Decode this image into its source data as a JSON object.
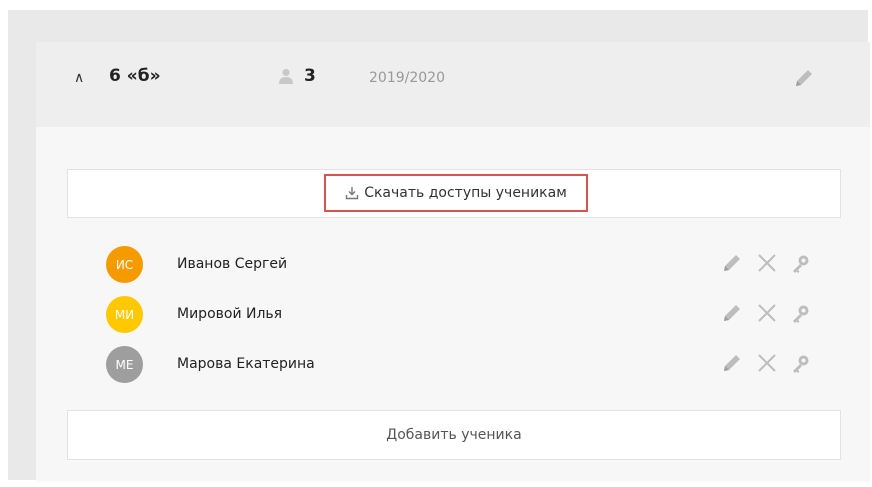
{
  "class_card": {
    "name": "6 «б»",
    "student_count": "3",
    "school_year": "2019/2020",
    "toggle_icon": "chevron-up-icon",
    "edit_icon": "pencil-icon"
  },
  "download": {
    "label": "Скачать доступы ученикам",
    "icon": "download-icon",
    "highlight_color": "#d9534f"
  },
  "students": [
    {
      "initials": "ИС",
      "name": "Иванов Сергей",
      "avatar_color": "#f59b00"
    },
    {
      "initials": "МИ",
      "name": "Мировой Илья",
      "avatar_color": "#ffc800"
    },
    {
      "initials": "МЕ",
      "name": "Марова Екатерина",
      "avatar_color": "#9e9e9e"
    }
  ],
  "student_actions": [
    "pencil-icon",
    "close-icon",
    "key-icon"
  ],
  "add_student_label": "Добавить ученика"
}
